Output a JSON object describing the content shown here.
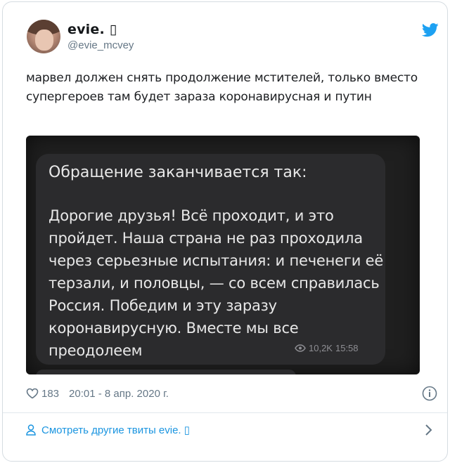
{
  "author": {
    "display_name": "evie. ▯",
    "handle": "@evie_mcvey"
  },
  "tweet": {
    "text": "марвел должен снять продолжение мстителей, только вместо супергероев там будет зараза коронавирусная и путин"
  },
  "media": {
    "heading": "Обращение заканчивается так:",
    "body": "Дорогие друзья! Всё проходит, и это пройдет. Наша страна не раз проходила через серьезные испытания: и печенеги её терзали, и половцы, — со всем справилась Россия. Победим и эту заразу коронавирусную. Вместе мы все преодолеем",
    "views": "10,2K",
    "time": "15:58"
  },
  "meta": {
    "likes": "183",
    "timestamp": "20:01 - 8 апр. 2020 г."
  },
  "footer": {
    "more_tweets_label": "Смотреть другие твиты evie. ▯"
  },
  "colors": {
    "accent": "#1b95e0",
    "muted": "#657786",
    "media_bg": "#1f1f1f",
    "bubble_bg": "#2b2b2d"
  },
  "icons": [
    "twitter-bird-icon",
    "heart-icon",
    "info-icon",
    "person-icon",
    "eye-icon",
    "chevron-right-icon"
  ]
}
